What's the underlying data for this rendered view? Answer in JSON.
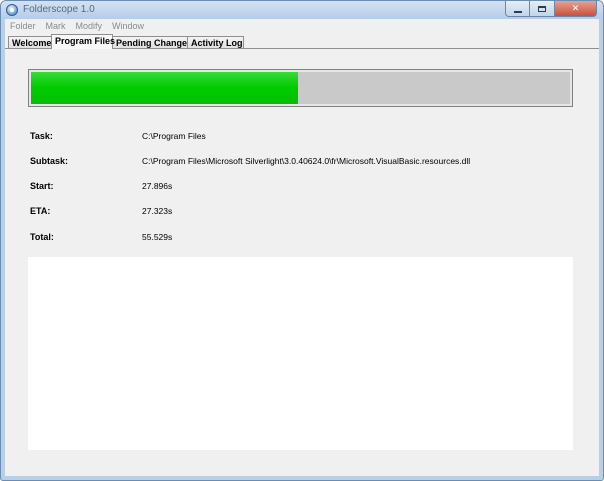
{
  "window": {
    "title": "Folderscope 1.0",
    "icon": "folderscope-app-icon",
    "controls": {
      "minimize": "minimize-icon",
      "maximize": "maximize-icon",
      "close_label": "✕"
    }
  },
  "menu": {
    "items": [
      {
        "label": "Folder"
      },
      {
        "label": "Mark"
      },
      {
        "label": "Modify"
      },
      {
        "label": "Window"
      }
    ]
  },
  "tabs": {
    "items": [
      {
        "label": "Welcome",
        "active": false
      },
      {
        "label": "Program Files",
        "active": true
      },
      {
        "label": "Pending Changes",
        "active": false
      },
      {
        "label": "Activity Log",
        "active": false
      }
    ]
  },
  "progress": {
    "fraction": 0.495,
    "fill_color": "#02cc02",
    "track_color": "#c9c9c9"
  },
  "info": {
    "task": {
      "label": "Task:",
      "value": "C:\\Program Files"
    },
    "subtask": {
      "label": "Subtask:",
      "value": "C:\\Program Files\\Microsoft Silverlight\\3.0.40624.0\\fr\\Microsoft.VisualBasic.resources.dll"
    },
    "start": {
      "label": "Start:",
      "value": "27.896s"
    },
    "eta": {
      "label": "ETA:",
      "value": "27.323s"
    },
    "total": {
      "label": "Total:",
      "value": "55.529s"
    }
  }
}
